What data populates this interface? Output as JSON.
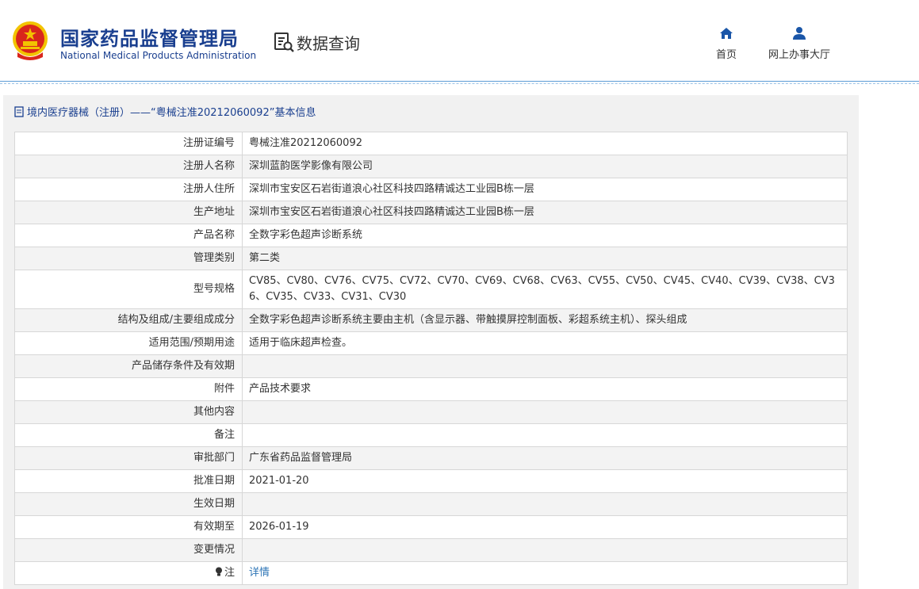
{
  "header": {
    "logo_cn": "国家药品监督管理局",
    "logo_en": "National Medical Products Administration",
    "section": "数据查询",
    "nav": [
      {
        "label": "首页",
        "icon": "home-icon"
      },
      {
        "label": "网上办事大厅",
        "icon": "user-icon"
      }
    ]
  },
  "panel": {
    "title": "境内医疗器械（注册）——“粤械注准20212060092”基本信息"
  },
  "rows": [
    {
      "key": "注册证编号",
      "value": "粤械注准20212060092"
    },
    {
      "key": "注册人名称",
      "value": "深圳蓝韵医学影像有限公司"
    },
    {
      "key": "注册人住所",
      "value": "深圳市宝安区石岩街道浪心社区科技四路精诚达工业园B栋一层"
    },
    {
      "key": "生产地址",
      "value": "深圳市宝安区石岩街道浪心社区科技四路精诚达工业园B栋一层"
    },
    {
      "key": "产品名称",
      "value": "全数字彩色超声诊断系统"
    },
    {
      "key": "管理类别",
      "value": "第二类"
    },
    {
      "key": "型号规格",
      "value": "CV85、CV80、CV76、CV75、CV72、CV70、CV69、CV68、CV63、CV55、CV50、CV45、CV40、CV39、CV38、CV36、CV35、CV33、CV31、CV30"
    },
    {
      "key": "结构及组成/主要组成成分",
      "value": "全数字彩色超声诊断系统主要由主机（含显示器、带触摸屏控制面板、彩超系统主机）、探头组成"
    },
    {
      "key": "适用范围/预期用途",
      "value": "适用于临床超声检查。"
    },
    {
      "key": "产品储存条件及有效期",
      "value": ""
    },
    {
      "key": "附件",
      "value": "产品技术要求"
    },
    {
      "key": "其他内容",
      "value": ""
    },
    {
      "key": "备注",
      "value": ""
    },
    {
      "key": "审批部门",
      "value": "广东省药品监督管理局"
    },
    {
      "key": "批准日期",
      "value": "2021-01-20"
    },
    {
      "key": "生效日期",
      "value": ""
    },
    {
      "key": "有效期至",
      "value": "2026-01-19"
    },
    {
      "key": "变更情况",
      "value": ""
    },
    {
      "key": "注",
      "value": "详情"
    }
  ],
  "colors": {
    "brand_blue": "#1a3f8f",
    "nav_blue": "#1a56a8",
    "link_blue": "#2e75b6",
    "emblem_red": "#d9261c",
    "emblem_gold": "#f2c300"
  }
}
